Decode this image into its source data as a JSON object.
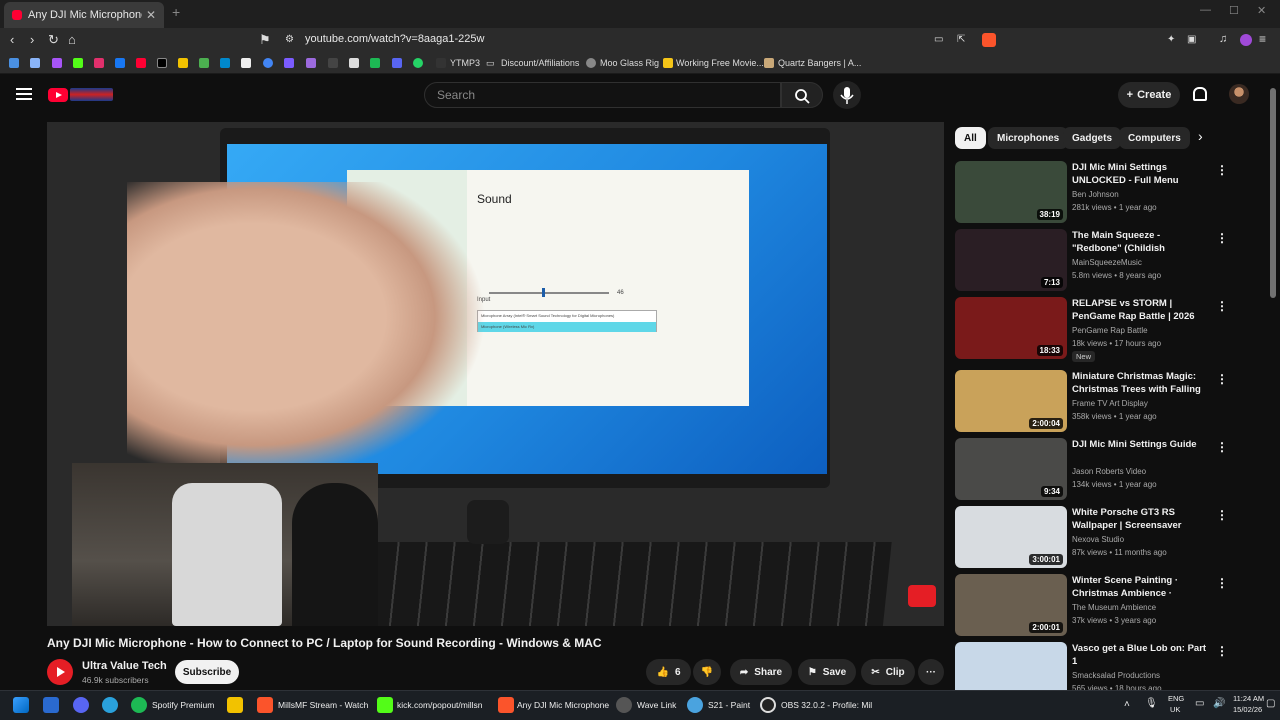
{
  "browser": {
    "tab_title": "Any DJI Mic Microphone - How",
    "url": "youtube.com/watch?v=8aaga1-225w",
    "bookmarks": [
      "YTMP3",
      "Discount/Affiliations",
      "Moo Glass Rig",
      "Working Free Movie...",
      "Quartz Bangers | A..."
    ]
  },
  "masthead": {
    "search_placeholder": "Search",
    "create_label": "Create"
  },
  "video": {
    "title": "Any DJI Mic Microphone - How to Connect to PC / Laptop for Sound Recording - Windows & MAC",
    "channel_name": "Ultra Value Tech",
    "subscribers": "46.9k subscribers",
    "subscribe_label": "Subscribe",
    "likes": "6",
    "share_label": "Share",
    "save_label": "Save",
    "clip_label": "Clip",
    "on_screen": {
      "settings_header": "Sound",
      "volume_value": "46",
      "input_label": "Input",
      "device_1": "Microphone Array (Intel® Smart Sound Technology for Digital Microphones)",
      "device_2": "Microphone (Wireless Mic Rx)"
    }
  },
  "chips": [
    "All",
    "Microphones",
    "Gadgets",
    "Computers"
  ],
  "recommendations": [
    {
      "title": "DJI Mic Mini Settings UNLOCKED - Full Menu Guide",
      "channel": "Ben Johnson",
      "meta": "281k views • 1 year ago",
      "duration": "38:19",
      "thumb_color": "#3a4a3a"
    },
    {
      "title": "The Main Squeeze - \"Redbone\" (Childish Gambino Cover)",
      "channel": "MainSqueezeMusic",
      "meta": "5.8m views • 8 years ago",
      "duration": "7:13",
      "thumb_color": "#2a1e24"
    },
    {
      "title": "RELAPSE vs STORM | PenGame Rap Battle | 2026",
      "channel": "PenGame Rap Battle",
      "meta": "18k views • 17 hours ago",
      "duration": "18:33",
      "badge": "New",
      "thumb_color": "#7a1a1a"
    },
    {
      "title": "Miniature Christmas Magic: Christmas Trees with Falling ...",
      "channel": "Frame TV Art Display",
      "meta": "358k views • 1 year ago",
      "duration": "2:00:04",
      "thumb_color": "#c9a25a"
    },
    {
      "title": "DJI Mic Mini Settings Guide",
      "channel": "Jason Roberts Video",
      "meta": "134k views • 1 year ago",
      "duration": "9:34",
      "thumb_color": "#4a4a48"
    },
    {
      "title": "White Porsche GT3 RS Wallpaper | Screensaver",
      "channel": "Nexova Studio",
      "meta": "87k views • 11 months ago",
      "duration": "3:00:01",
      "thumb_color": "#d8dce0"
    },
    {
      "title": "Winter Scene Painting · Christmas Ambience · Vintage...",
      "channel": "The Museum Ambience",
      "meta": "37k views • 3 years ago",
      "duration": "2:00:01",
      "thumb_color": "#6a5f50"
    },
    {
      "title": "Vasco get a Blue Lob on: Part 1",
      "channel": "Smacksalad Productions",
      "meta": "565 views • 18 hours ago",
      "duration": "",
      "thumb_color": "#c8d8e8"
    }
  ],
  "taskbar": {
    "items": [
      "Spotify Premium",
      "MillsMF Stream - Watch",
      "kick.com/popout/millsn",
      "Any DJI Mic Microphone",
      "Wave Link",
      "S21 - Paint",
      "OBS 32.0.2 - Profile: Mil"
    ],
    "lang": "ENG",
    "region": "UK",
    "time": "11:24 AM",
    "date": "15/02/26"
  }
}
